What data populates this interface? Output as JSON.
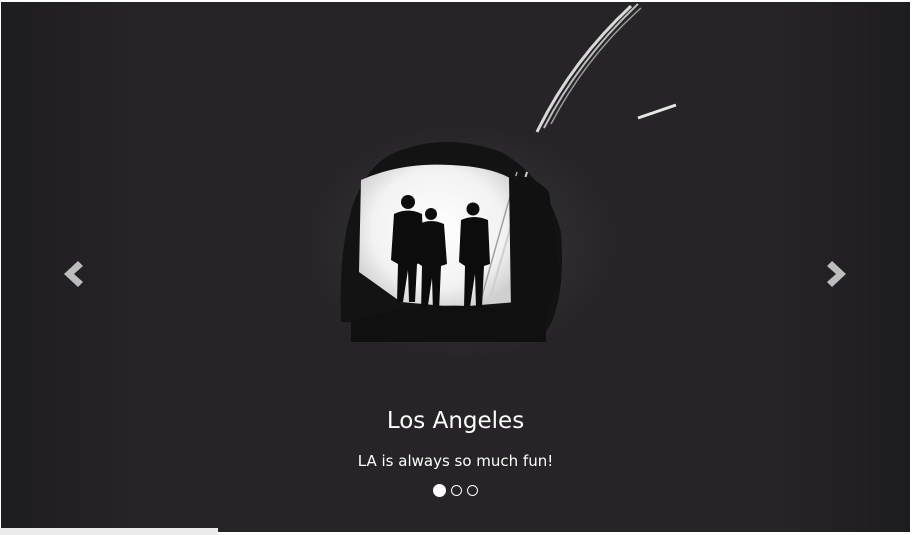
{
  "carousel": {
    "slide": {
      "title": "Los Angeles",
      "caption": "LA is always so much fun!"
    },
    "indicators": [
      {
        "active": true
      },
      {
        "active": false
      },
      {
        "active": false
      }
    ],
    "prev_icon": "chevron-left-icon",
    "next_icon": "chevron-right-icon"
  }
}
